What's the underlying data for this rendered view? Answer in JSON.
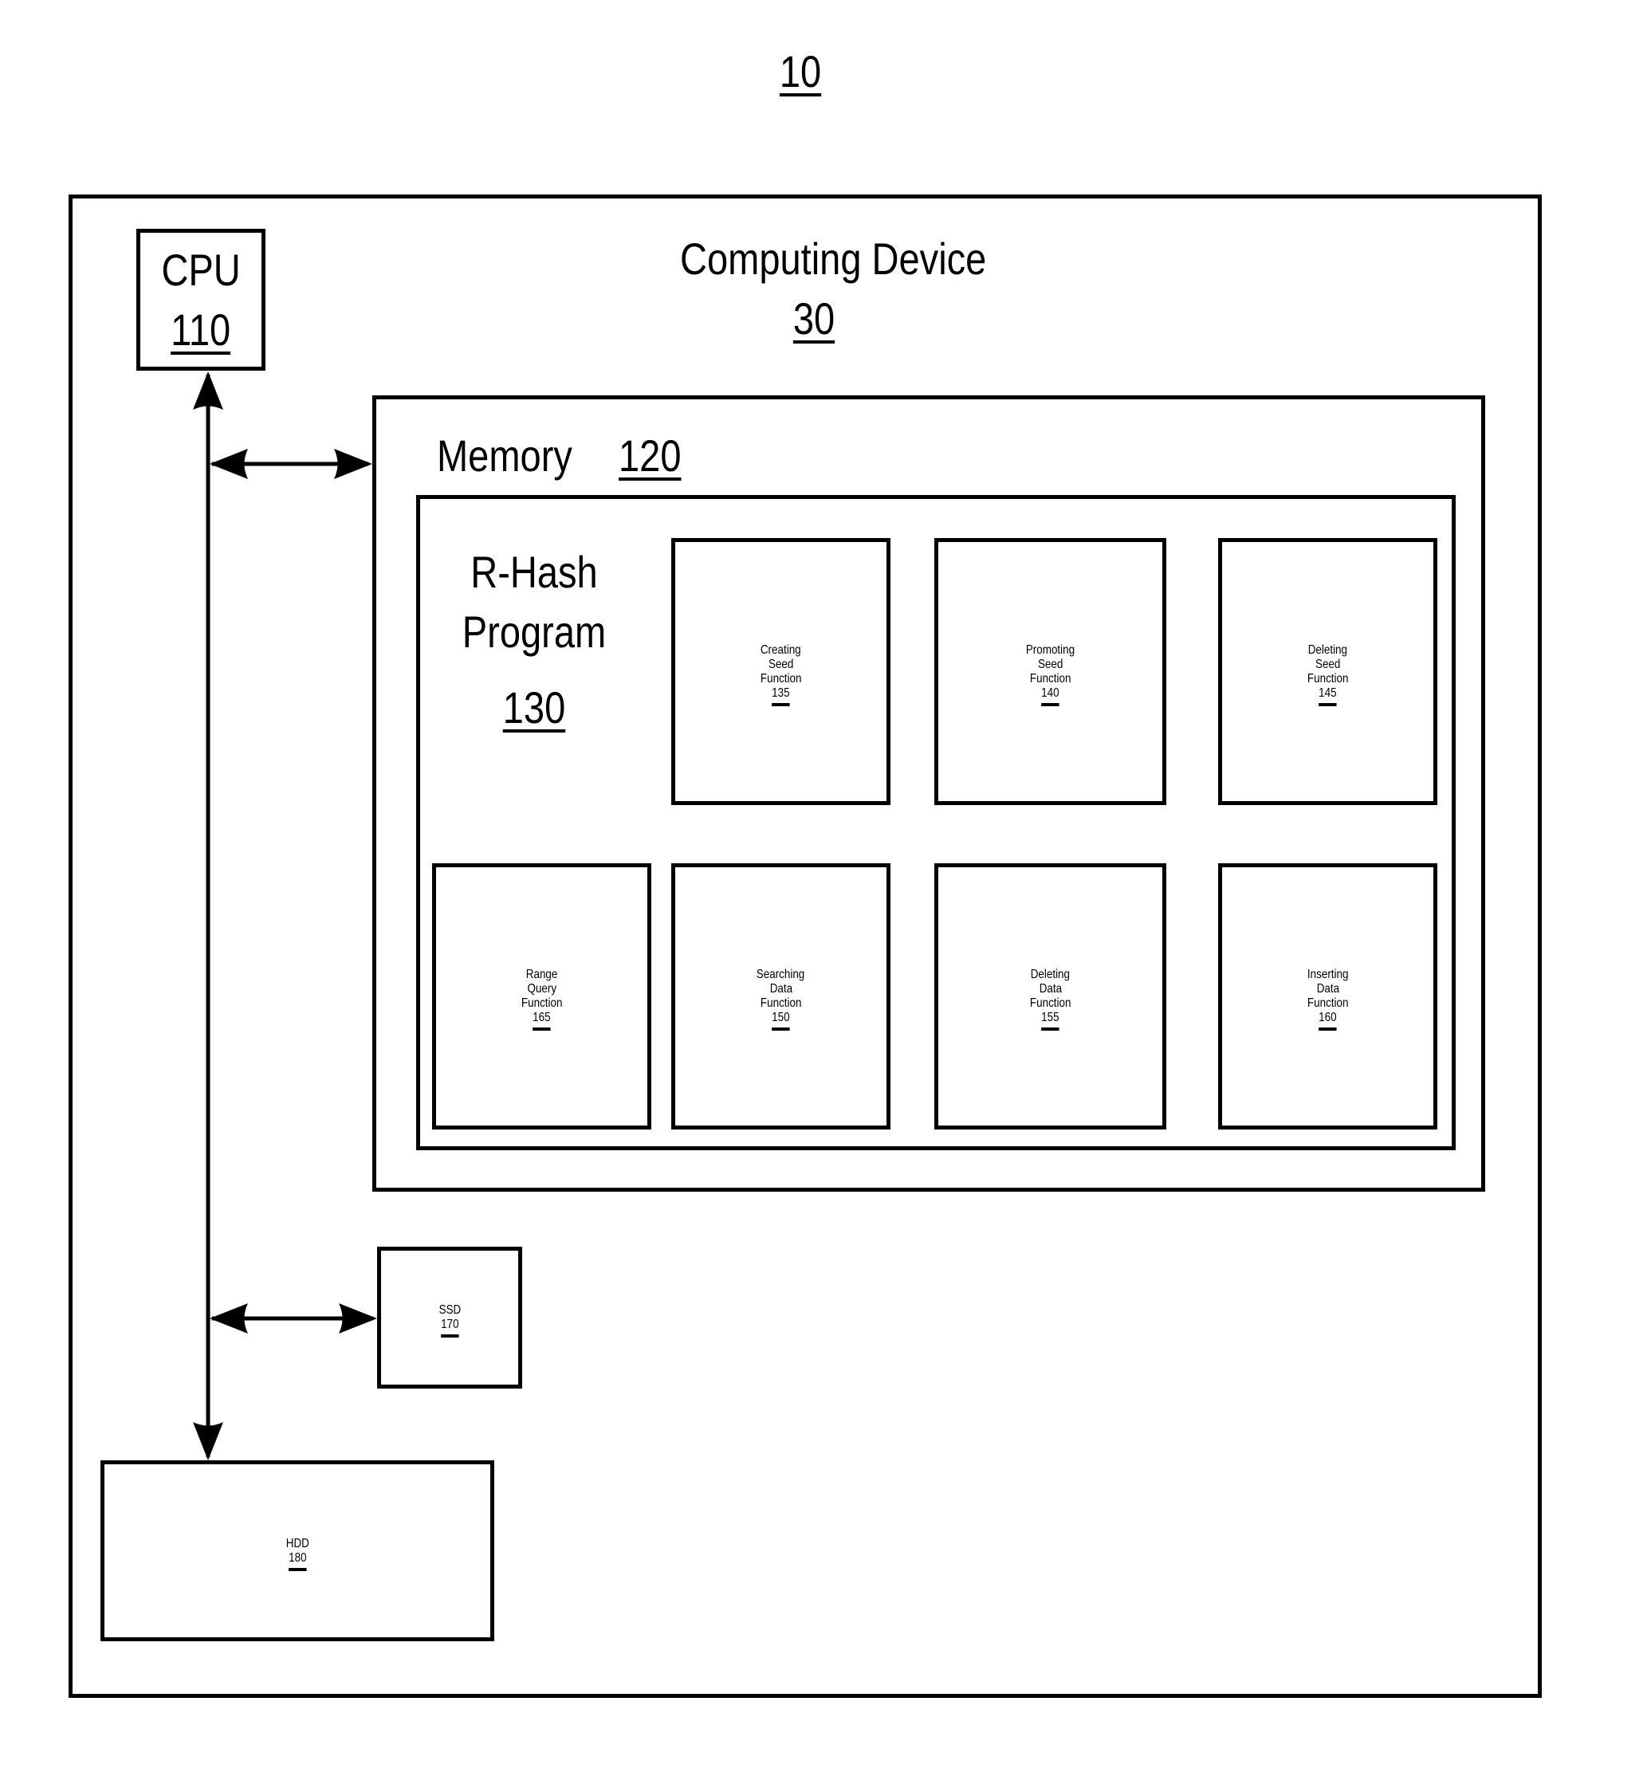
{
  "figure": {
    "ref": "10"
  },
  "computing_device": {
    "title": "Computing Device",
    "ref": "30"
  },
  "cpu": {
    "title": "CPU",
    "ref": "110"
  },
  "memory": {
    "title": "Memory",
    "ref": "120"
  },
  "program": {
    "title_line1": "R-Hash",
    "title_line2": "Program",
    "ref": "130"
  },
  "functions": [
    {
      "lines": [
        "Creating",
        "Seed",
        "Function"
      ],
      "ref": "135"
    },
    {
      "lines": [
        "Promoting",
        "Seed",
        "Function"
      ],
      "ref": "140"
    },
    {
      "lines": [
        "Deleting",
        "Seed",
        "Function"
      ],
      "ref": "145"
    },
    {
      "lines": [
        "Range",
        "Query",
        "Function"
      ],
      "ref": "165"
    },
    {
      "lines": [
        "Searching",
        "Data",
        "Function"
      ],
      "ref": "150"
    },
    {
      "lines": [
        "Deleting",
        "Data",
        "Function"
      ],
      "ref": "155"
    },
    {
      "lines": [
        "Inserting",
        "Data",
        "Function"
      ],
      "ref": "160"
    }
  ],
  "ssd": {
    "title": "SSD",
    "ref": "170"
  },
  "hdd": {
    "title": "HDD",
    "ref": "180"
  }
}
